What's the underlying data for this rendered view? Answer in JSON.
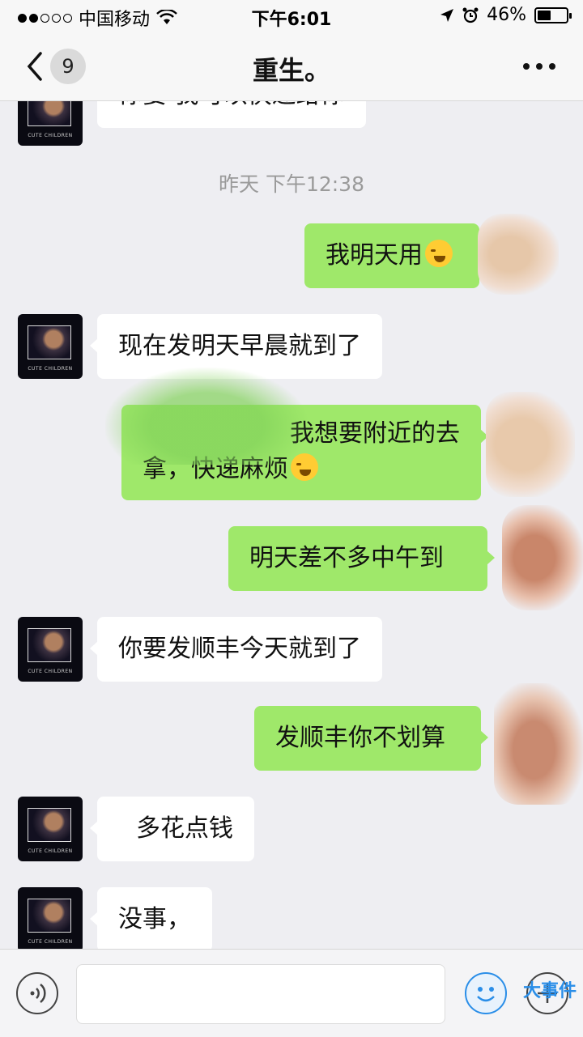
{
  "status": {
    "carrier": "中国移动",
    "time": "下午6:01",
    "battery": "46%",
    "battery_level": 0.46
  },
  "nav": {
    "back_count": "9",
    "title": "重生。"
  },
  "chat": {
    "timestamp": "昨天 下午12:38",
    "messages": [
      {
        "side": "in",
        "text": "你要 我可以快递给你"
      },
      {
        "side": "out",
        "text": "我明天用"
      },
      {
        "side": "in",
        "text": "现在发明天早晨就到了"
      },
      {
        "side": "out",
        "text_line1": "我想要附近的去",
        "text_line2": "拿，快递麻烦"
      },
      {
        "side": "out",
        "text": "明天差不多中午到"
      },
      {
        "side": "in",
        "text": "你要发顺丰今天就到了"
      },
      {
        "side": "out",
        "text": "发顺丰你不划算"
      },
      {
        "side": "in",
        "text": "多花点钱"
      },
      {
        "side": "in",
        "text": "没事，"
      }
    ],
    "avatar_caption": "CUTE CHILDREN"
  },
  "input": {
    "placeholder": ""
  },
  "watermark": "大事件",
  "colors": {
    "outgoing": "#9fe86a",
    "incoming": "#ffffff",
    "background": "#eeeef2"
  }
}
